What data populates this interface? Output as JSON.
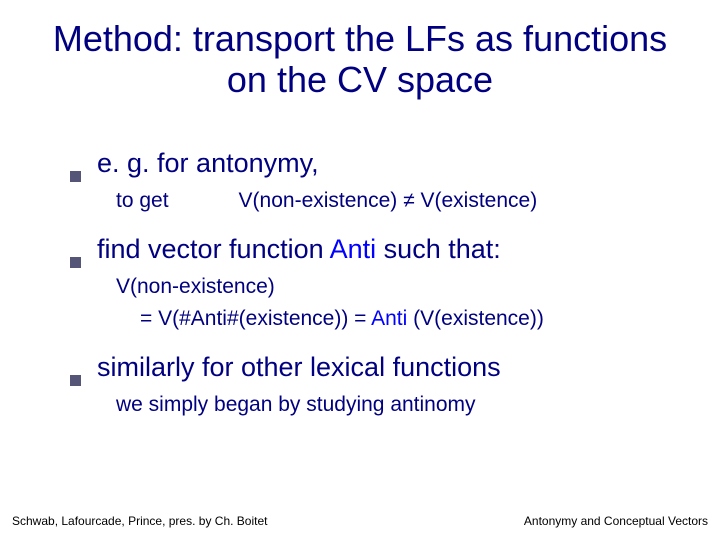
{
  "title": "Method: transport the LFs as functions on the CV space",
  "items": [
    {
      "text": "e. g. for antonymy,",
      "sub": [
        {
          "kind": "toget",
          "left": "to get",
          "right": "V(non-existence) ≠ V(existence)"
        }
      ]
    },
    {
      "text_pre": "find vector function ",
      "text_blue": "Anti",
      "text_post": " such that:",
      "sub": [
        {
          "kind": "plain",
          "line": "V(non-existence)"
        },
        {
          "kind": "indent",
          "pre": "= V(#Anti#(existence)) = ",
          "blue": "Anti ",
          "post": "(V(existence))"
        }
      ]
    },
    {
      "text": "similarly for other lexical functions",
      "sub": [
        {
          "kind": "plain",
          "line": "we simply began by studying antinomy"
        }
      ]
    }
  ],
  "footer": {
    "left": "Schwab, Lafourcade, Prince, pres. by Ch. Boitet",
    "right": "Antonymy and Conceptual Vectors"
  }
}
